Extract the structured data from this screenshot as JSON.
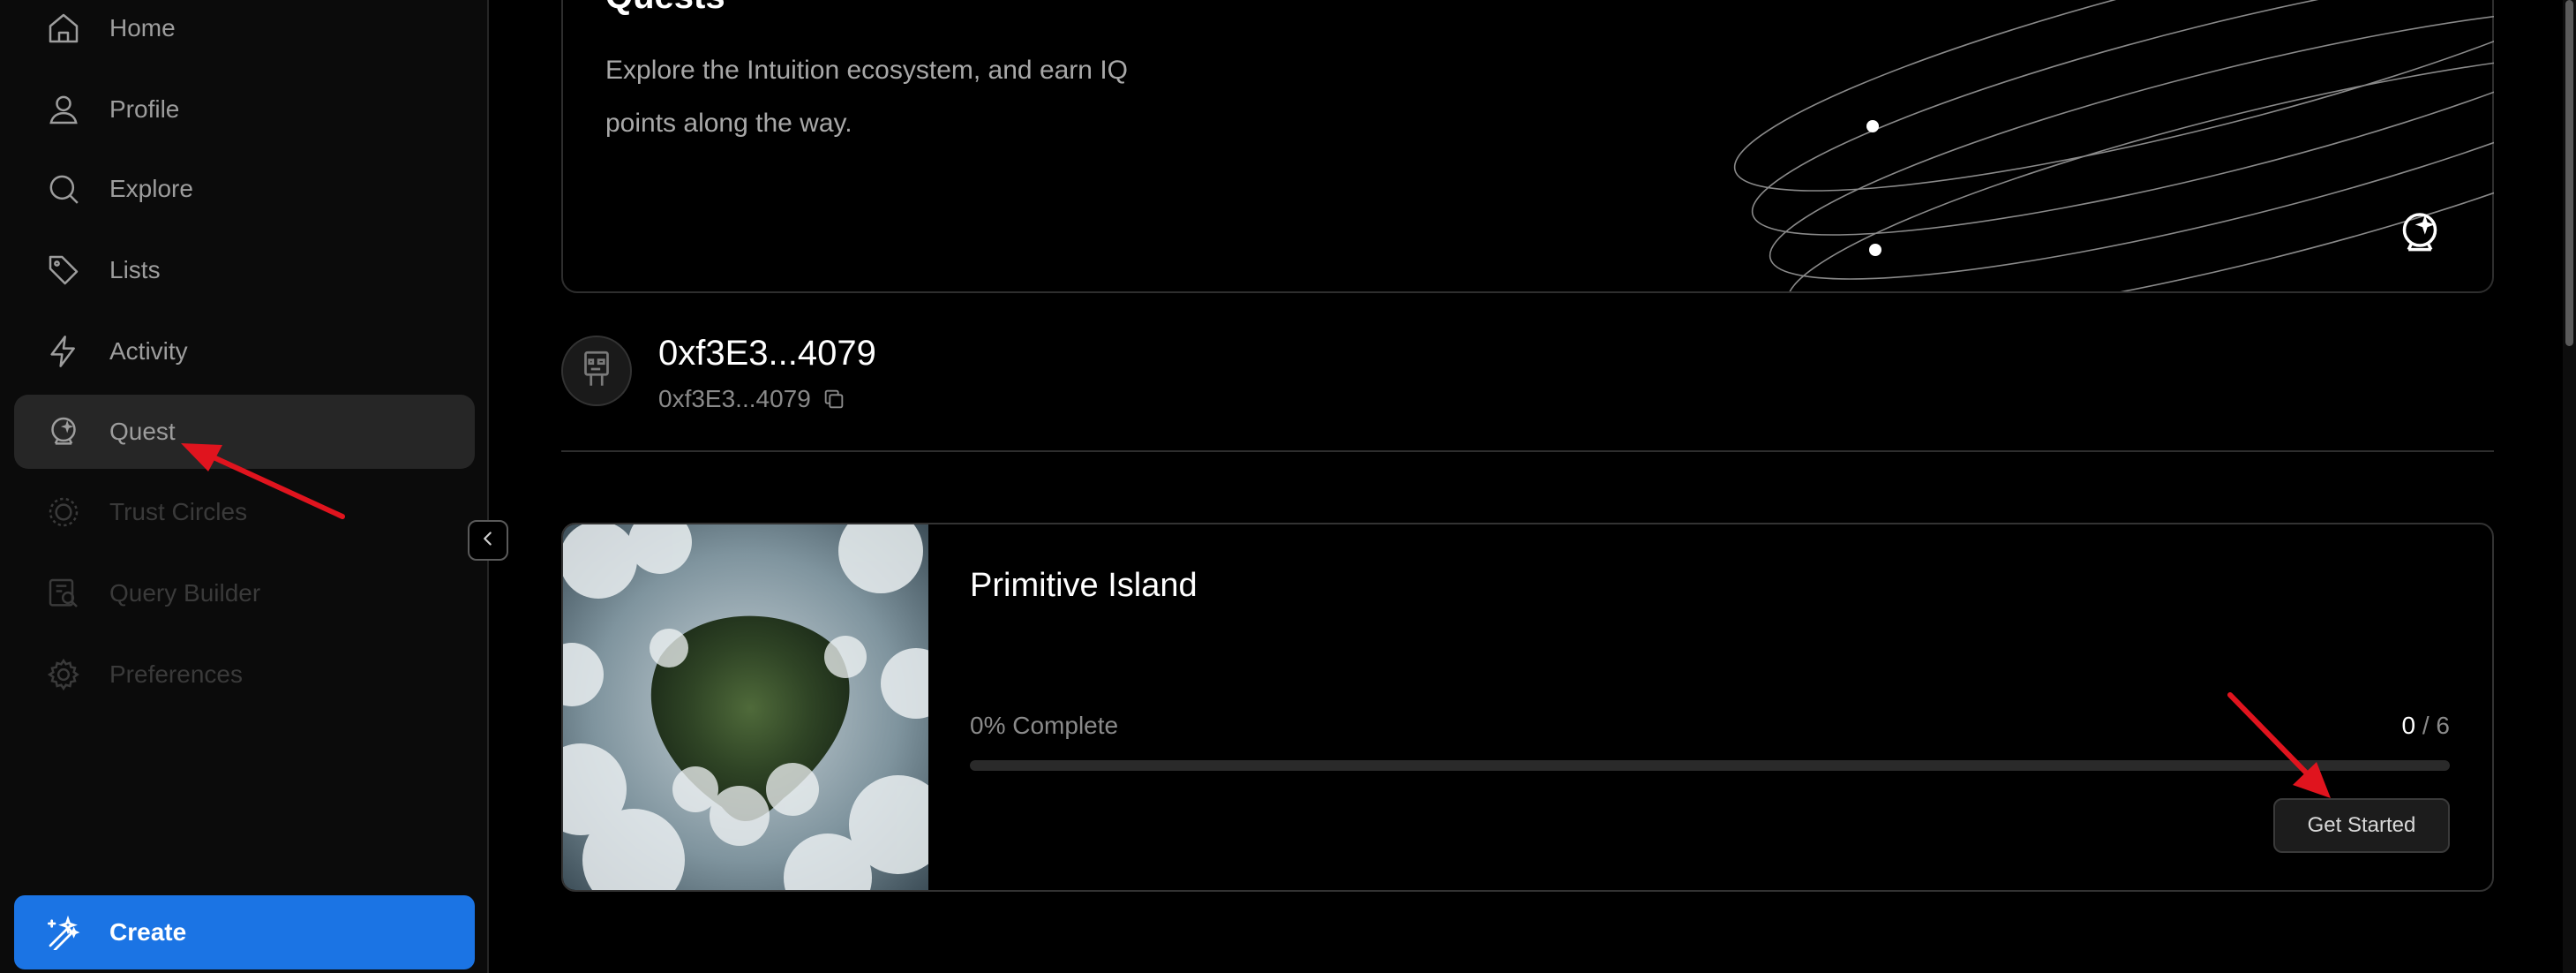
{
  "sidebar": {
    "items": [
      {
        "label": "Home",
        "icon": "home-icon"
      },
      {
        "label": "Profile",
        "icon": "user-icon"
      },
      {
        "label": "Explore",
        "icon": "search-icon"
      },
      {
        "label": "Lists",
        "icon": "tag-icon"
      },
      {
        "label": "Activity",
        "icon": "lightning-icon"
      },
      {
        "label": "Quest",
        "icon": "crystal-ball-icon",
        "active": true
      },
      {
        "label": "Trust Circles",
        "icon": "circle-icon",
        "disabled": true
      },
      {
        "label": "Query Builder",
        "icon": "query-icon",
        "disabled": true
      },
      {
        "label": "Preferences",
        "icon": "gear-icon",
        "disabled": true
      }
    ],
    "create_label": "Create"
  },
  "quests": {
    "title": "Quests",
    "description": "Explore the Intuition ecosystem, and earn IQ points along the way."
  },
  "profile": {
    "address": "0xf3E3...4079",
    "address_sub": "0xf3E3...4079"
  },
  "quest_card": {
    "title": "Primitive Island",
    "progress_label": "0% Complete",
    "completed": "0",
    "separator": " / ",
    "total": "6",
    "progress_fraction": 0,
    "button_label": "Get Started"
  },
  "colors": {
    "accent": "#1b74e4",
    "annotation_arrow": "#e0141e"
  }
}
